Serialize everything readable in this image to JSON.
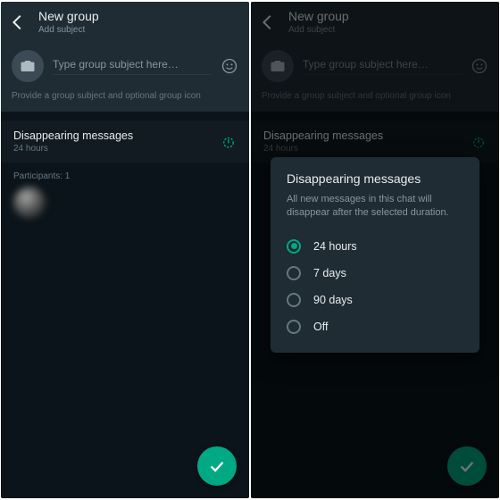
{
  "appbar": {
    "title": "New group",
    "subtitle": "Add subject"
  },
  "subject": {
    "placeholder": "Type group subject here…",
    "helper": "Provide a group subject and optional group icon"
  },
  "disappearing": {
    "title": "Disappearing messages",
    "value": "24 hours"
  },
  "participants": {
    "label": "Participants: 1"
  },
  "dialog": {
    "title": "Disappearing messages",
    "description": "All new messages in this chat will disappear after the selected duration.",
    "options": [
      "24 hours",
      "7 days",
      "90 days",
      "Off"
    ],
    "selected_index": 0
  },
  "colors": {
    "accent": "#00a884",
    "bg": "#0b141a",
    "panel": "#1f2c34"
  }
}
